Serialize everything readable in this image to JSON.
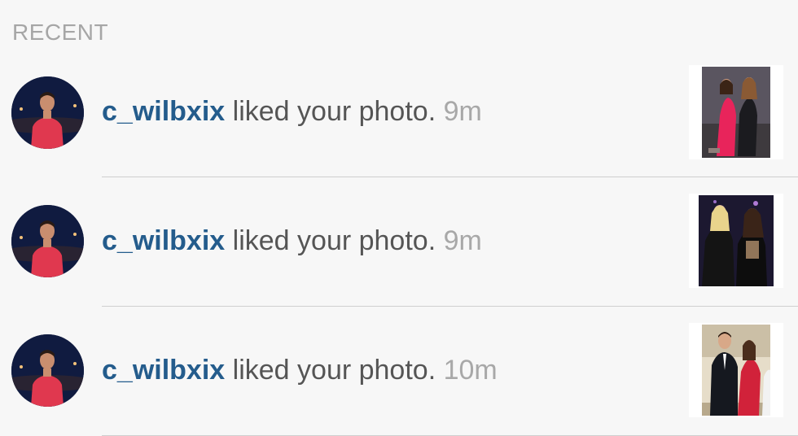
{
  "section": {
    "title": "RECENT"
  },
  "notifications": [
    {
      "username": "c_wilbxix",
      "action": "liked your photo.",
      "time": "9m"
    },
    {
      "username": "c_wilbxix",
      "action": "liked your photo.",
      "time": "9m"
    },
    {
      "username": "c_wilbxix",
      "action": "liked your photo.",
      "time": "10m"
    }
  ],
  "colors": {
    "username": "#245c8c",
    "text": "#555555",
    "timestamp": "#a8a8a8",
    "header": "#a6a6a6",
    "background": "#f7f7f7",
    "divider": "#cfcfcf"
  }
}
